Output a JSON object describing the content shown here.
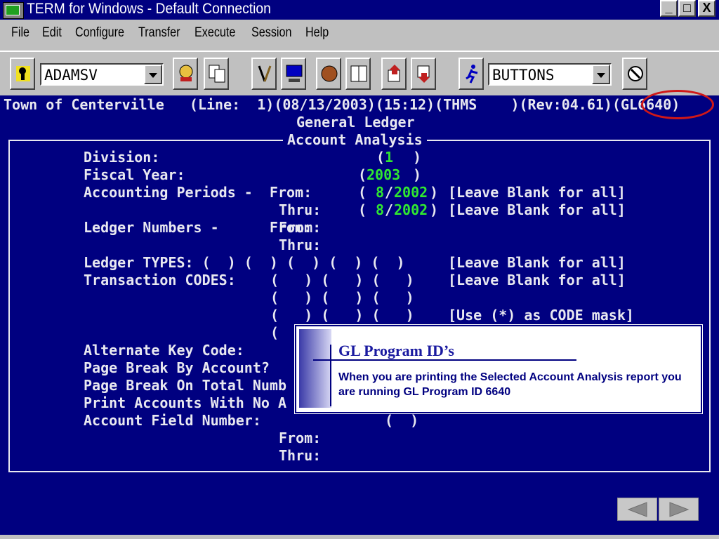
{
  "window": {
    "title": "TERM for Windows - Default Connection",
    "minimize_label": "_",
    "maximize_label": "□",
    "close_label": "X"
  },
  "menu": {
    "items": [
      "File",
      "Edit",
      "Configure",
      "Transfer",
      "Execute",
      "Session",
      "Help"
    ]
  },
  "toolbar": {
    "session_value": "ADAMSV",
    "buttons_value": "BUTTONS",
    "icons": [
      "connect-icon",
      "phone-icon",
      "copy-icon",
      "tools-icon",
      "computer-icon",
      "baseball-glove-icon",
      "book-icon",
      "upload-icon",
      "download-icon",
      "runner-icon",
      "settings-icon"
    ]
  },
  "terminal": {
    "status_line": "Town of Centerville   (Line:  1)(08/13/2003)(15:12)(THMS    )(Rev:04.61)(GL6640)",
    "header": "General Ledger",
    "frame_title": "Account Analysis",
    "lines": [
      {
        "text": "Division:"
      },
      {
        "text": "Fiscal Year:"
      },
      {
        "text": "Accounting Periods -  From:"
      },
      {
        "text": "Thru:"
      },
      {
        "text": "Ledger Numbers -      From:"
      },
      {
        "text": "Thru:"
      },
      {
        "text": "Ledger TYPES: (  ) (  ) (  ) (  ) (  )"
      },
      {
        "text": "Transaction CODES:"
      },
      {
        "text": "Alternate Key Code:"
      },
      {
        "text": "Page Break By Account?"
      },
      {
        "text": "Page Break On Total Numb"
      },
      {
        "text": "Print Accounts With No A"
      },
      {
        "text": "Account Field Number:"
      }
    ],
    "division_value": "1",
    "fiscal_year_value": "2003",
    "from_period_month": "8",
    "from_period_year": "2002",
    "thru_period_month": "8",
    "thru_period_year": "2002",
    "leave_blank_hint": "[Leave Blank for all]",
    "code_mask_hint": "[Use (*) as CODE mask]",
    "from_label": "From:",
    "thru_label": "Thru:",
    "transaction_codes_row": "(   ) (   ) (   )",
    "partial_paren": "(",
    "field_number_parens": "(  )"
  },
  "callout": {
    "title": "GL Program ID’s",
    "body": "When you are printing the Selected Account Analysis report you are running GL Program ID 6640"
  },
  "navigation": {
    "prev_icon": "triangle-left-icon",
    "next_icon": "triangle-right-icon"
  },
  "colors": {
    "terminal_bg": "#000080",
    "terminal_fg": "#e8e8f0",
    "field_value": "#30e830",
    "highlight_ring": "#d01818",
    "callout_title": "#1a1aa0"
  }
}
